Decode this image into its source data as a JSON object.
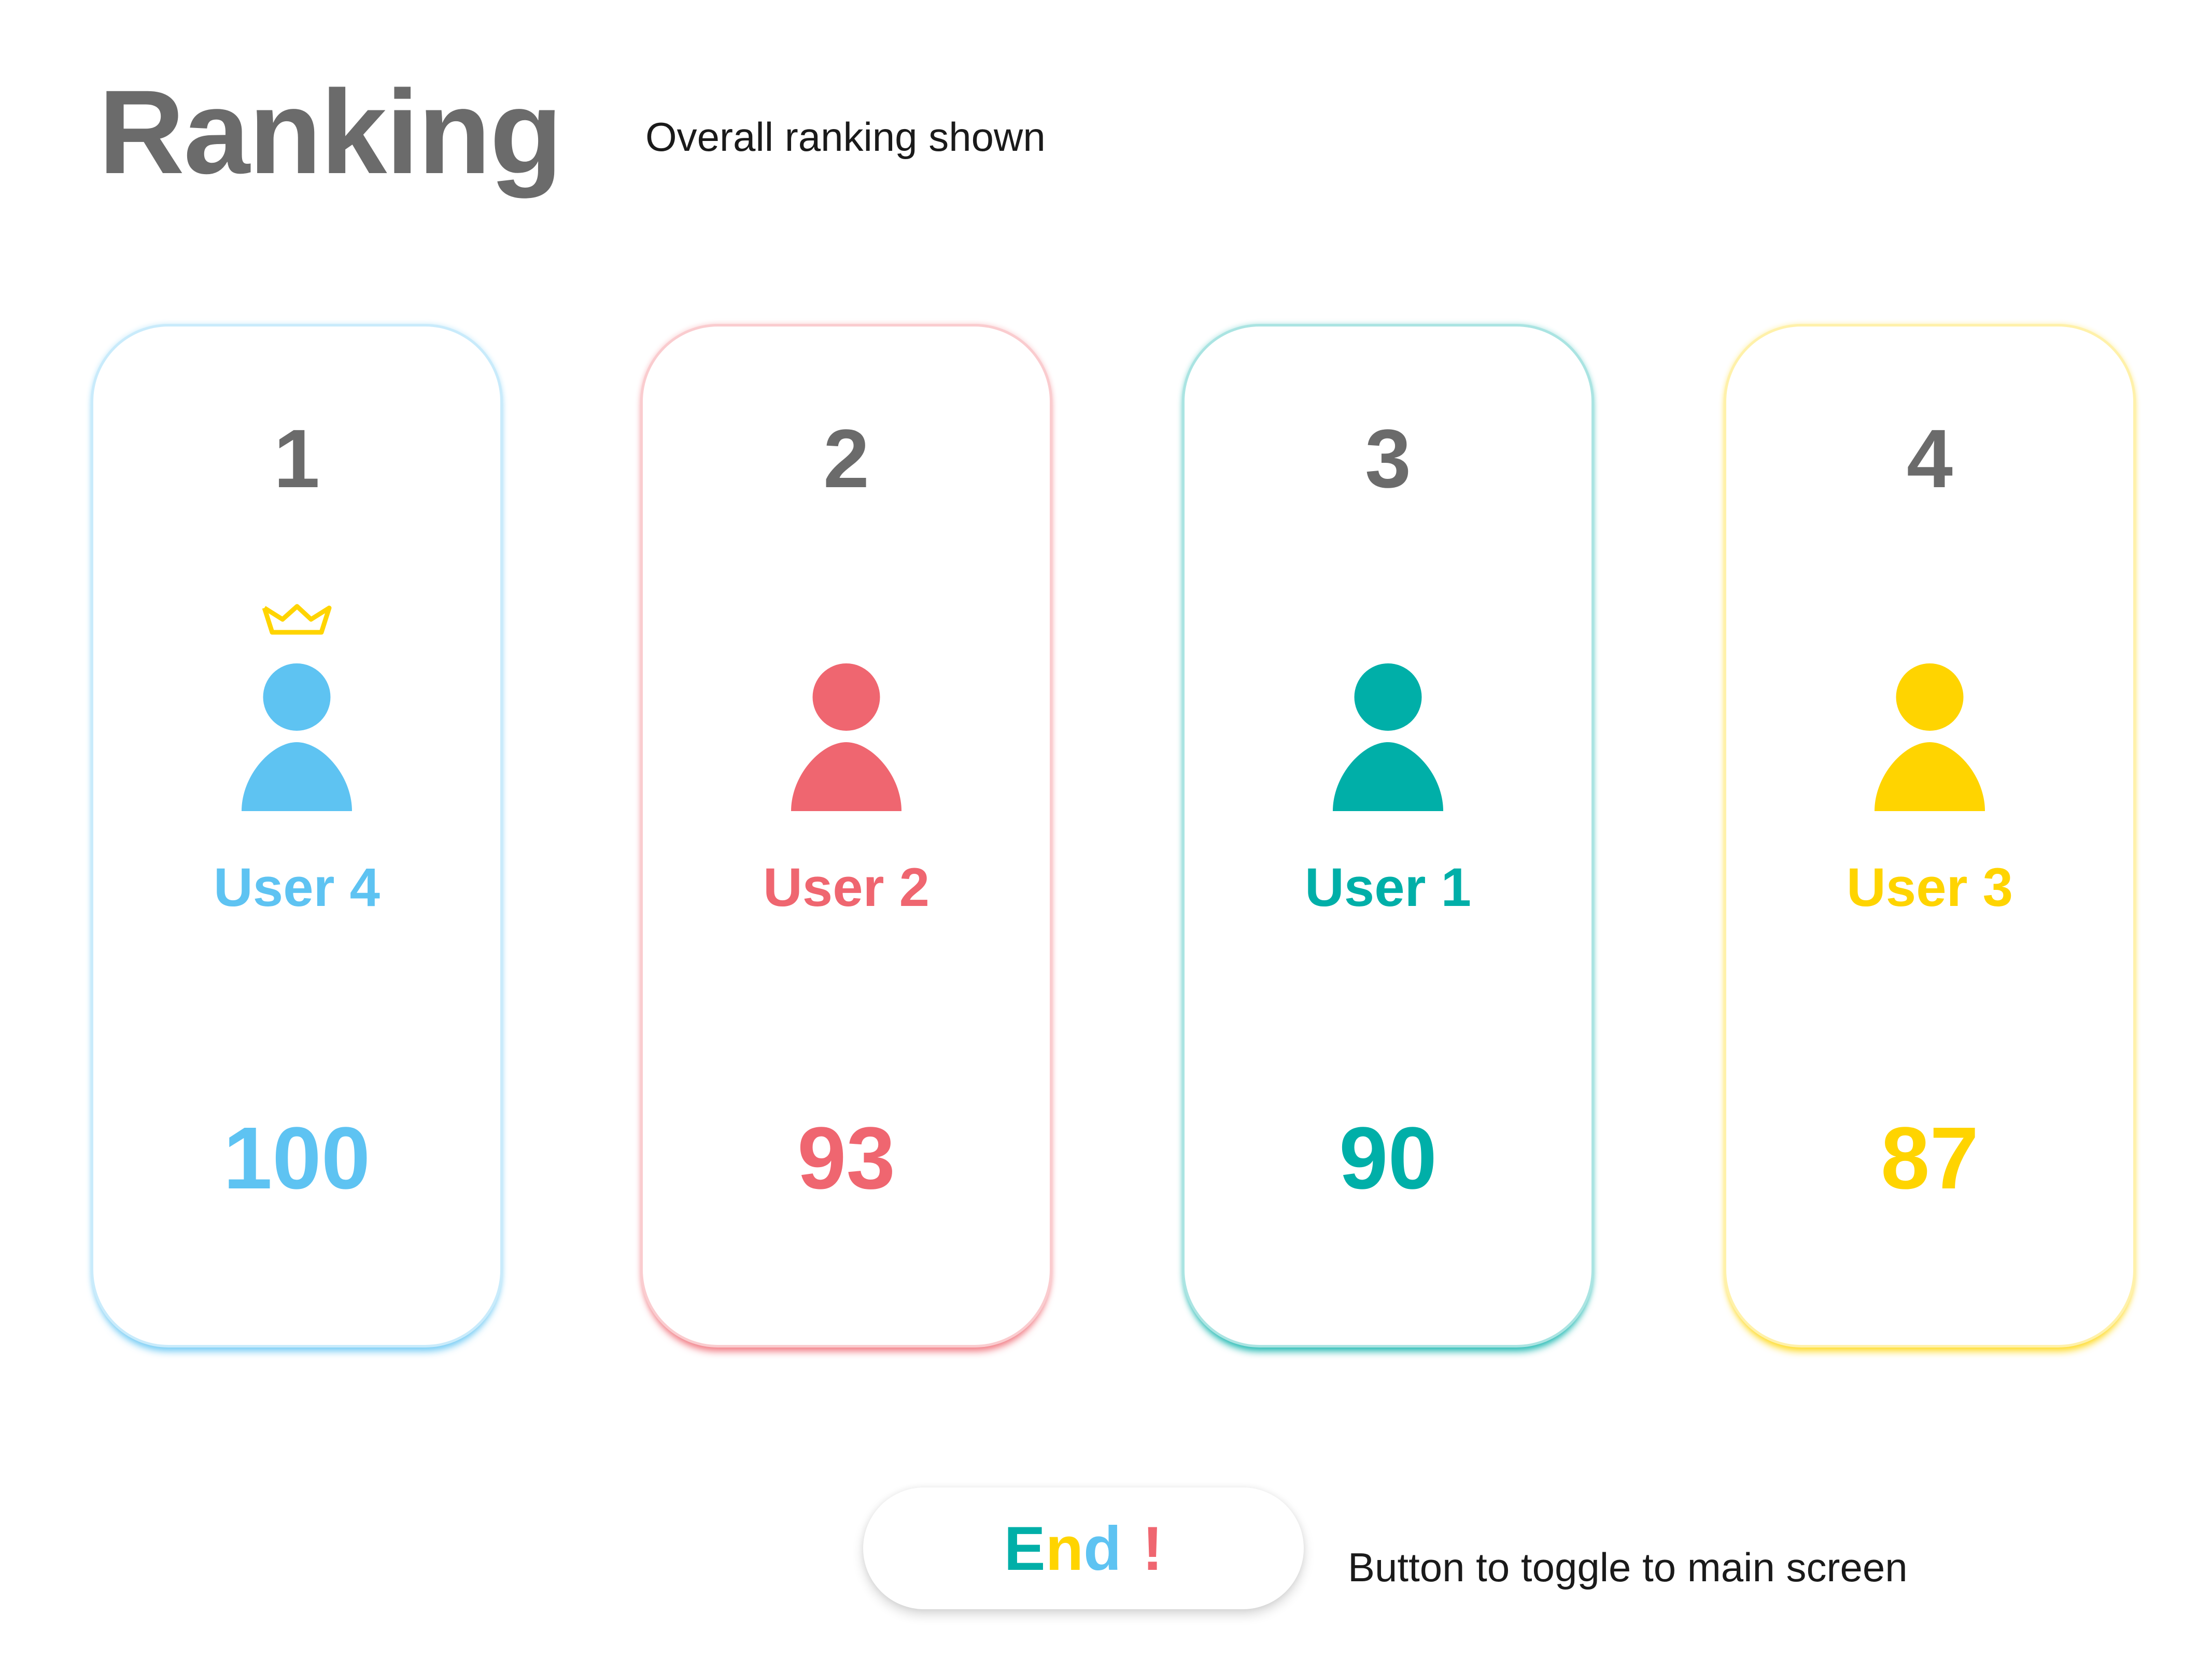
{
  "header": {
    "title": "Ranking",
    "subtitle": "Overall ranking shown"
  },
  "ranking": [
    {
      "rank": "1",
      "user": "User 4",
      "score": "100",
      "color": "#5ec3f2",
      "crown": true
    },
    {
      "rank": "2",
      "user": "User 2",
      "score": "93",
      "color": "#ef6670",
      "crown": false
    },
    {
      "rank": "3",
      "user": "User 1",
      "score": "90",
      "color": "#00afa8",
      "crown": false
    },
    {
      "rank": "4",
      "user": "User 3",
      "score": "87",
      "color": "#ffd400",
      "crown": false
    }
  ],
  "crown_color": "#ffd400",
  "footer": {
    "end_button": {
      "letters": [
        "E",
        "n",
        "d",
        " ",
        "!"
      ],
      "letter_colors": [
        "#00afa8",
        "#ffd400",
        "#5ec3f2",
        "#ffffff",
        "#ef6670"
      ]
    },
    "note": "Button to toggle to main screen"
  }
}
